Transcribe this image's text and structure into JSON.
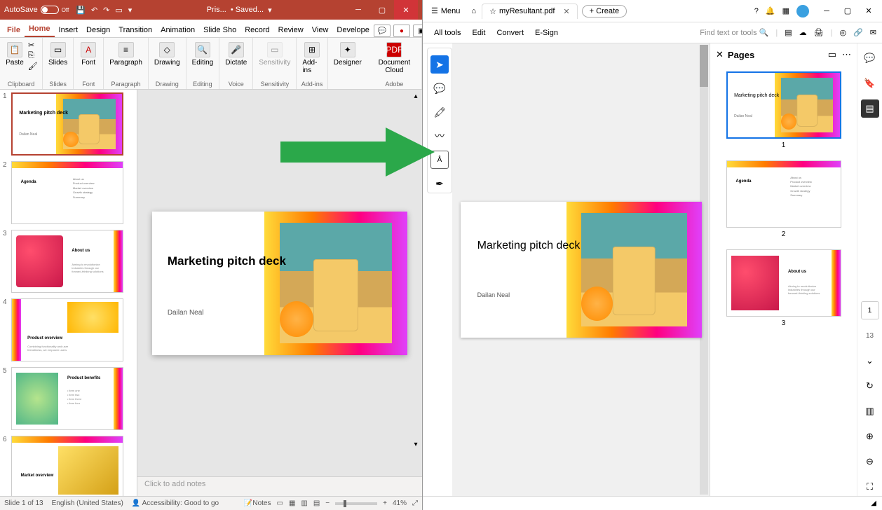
{
  "powerpoint": {
    "titlebar": {
      "autosave_label": "AutoSave",
      "autosave_state": "Off",
      "doc_name": "Pris...",
      "save_state": "• Saved..."
    },
    "tabs": [
      "File",
      "Home",
      "Insert",
      "Design",
      "Transition",
      "Animation",
      "Slide Sho",
      "Record",
      "Review",
      "View",
      "Develope"
    ],
    "active_tab": "Home",
    "ribbon": {
      "clipboard": {
        "label": "Clipboard",
        "paste": "Paste"
      },
      "slides": {
        "label": "Slides",
        "btn": "Slides"
      },
      "font": {
        "label": "Font",
        "btn": "Font"
      },
      "paragraph": {
        "label": "Paragraph",
        "btn": "Paragraph"
      },
      "drawing": {
        "label": "Drawing",
        "btn": "Drawing"
      },
      "editing": {
        "label": "Editing",
        "btn": "Editing"
      },
      "dictate": {
        "label": "Voice",
        "btn": "Dictate"
      },
      "sensitivity": {
        "label": "Sensitivity",
        "btn": "Sensitivity"
      },
      "addins": {
        "label": "Add-ins",
        "btn": "Add-ins"
      },
      "designer": {
        "btn": "Designer"
      },
      "adobe": {
        "label": "Adobe",
        "btn": "Document Cloud"
      }
    },
    "slides_list": [
      {
        "num": "1",
        "title": "Marketing pitch deck",
        "sub": "Dailan Neal",
        "layout": "title"
      },
      {
        "num": "2",
        "title": "Agenda",
        "layout": "agenda"
      },
      {
        "num": "3",
        "title": "About us",
        "layout": "aboutus"
      },
      {
        "num": "4",
        "title": "Product overview",
        "layout": "product"
      },
      {
        "num": "5",
        "title": "Product benefits",
        "layout": "benefits"
      },
      {
        "num": "6",
        "title": "Market overview",
        "layout": "market"
      }
    ],
    "main_slide": {
      "title": "Marketing pitch deck",
      "author": "Dailan Neal"
    },
    "notes_placeholder": "Click to add notes",
    "status": {
      "slide_pos": "Slide 1 of 13",
      "lang": "English (United States)",
      "accessibility": "Accessibility: Good to go",
      "notes_btn": "Notes",
      "zoom": "41%"
    }
  },
  "acrobat": {
    "titlebar": {
      "menu": "Menu",
      "tab_name": "myResultant.pdf",
      "create": "Create"
    },
    "toolbar": {
      "all_tools": "All tools",
      "edit": "Edit",
      "convert": "Convert",
      "esign": "E-Sign",
      "find": "Find text or tools"
    },
    "doc": {
      "title": "Marketing pitch deck",
      "author": "Dailan Neal"
    },
    "pages_panel": {
      "title": "Pages"
    },
    "pages": [
      {
        "num": "1",
        "title": "Marketing pitch deck",
        "sub": "Dailan Neal",
        "layout": "title"
      },
      {
        "num": "2",
        "title": "Agenda",
        "layout": "agenda"
      },
      {
        "num": "3",
        "title": "About us",
        "layout": "aboutus"
      }
    ],
    "page_indicator": "1",
    "total_pages": "13"
  }
}
